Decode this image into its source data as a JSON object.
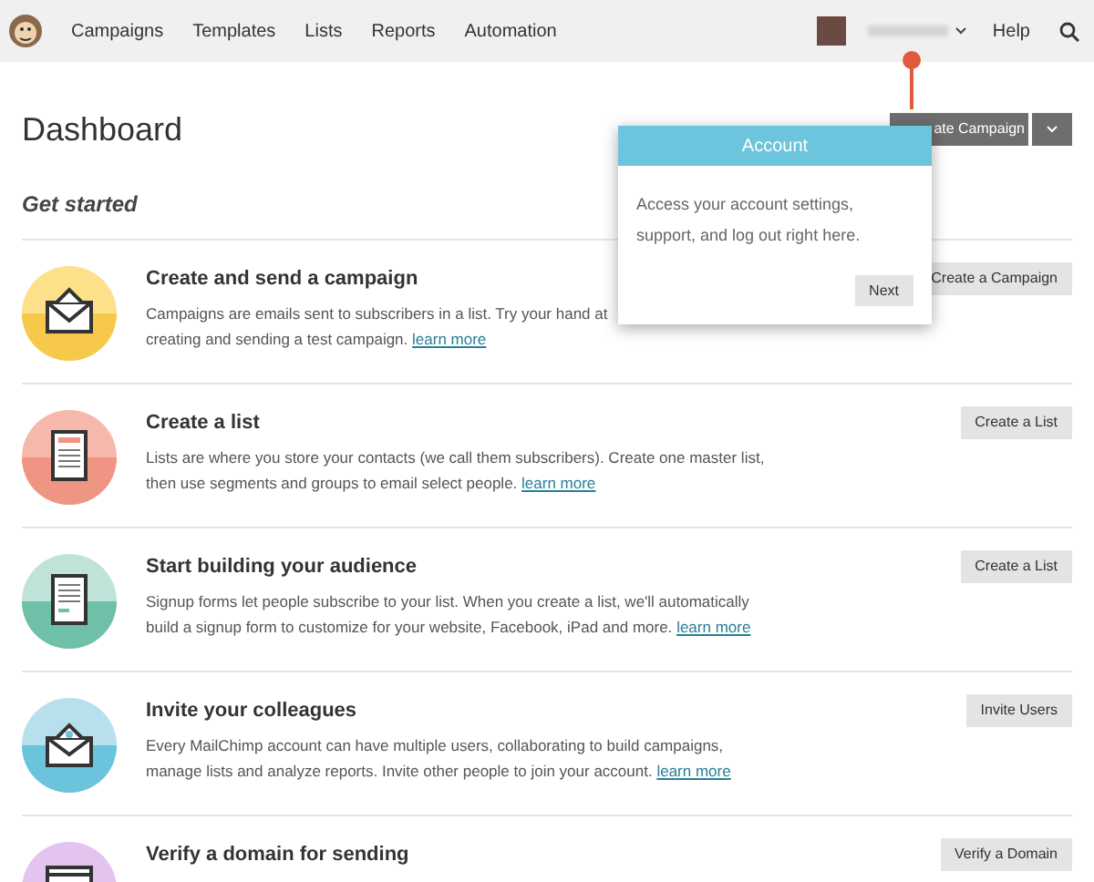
{
  "nav": {
    "items": [
      {
        "label": "Campaigns"
      },
      {
        "label": "Templates"
      },
      {
        "label": "Lists"
      },
      {
        "label": "Reports"
      },
      {
        "label": "Automation"
      }
    ],
    "help": "Help"
  },
  "page_title": "Dashboard",
  "primary_button": "ate Campaign",
  "section_title": "Get started",
  "tasks": [
    {
      "kind": "envelope",
      "title": "Create and send a campaign",
      "lines": [
        "Campaigns are emails sent to subscribers in a list. Try your hand at",
        "creating and sending a test campaign."
      ],
      "link": "learn more",
      "button": "Create a Campaign"
    },
    {
      "kind": "list",
      "title": "Create a list",
      "lines": [
        "Lists are where you store your contacts (we call them subscribers). Create one master list,",
        "then use segments and groups to email select people."
      ],
      "link": "learn more",
      "button": "Create a List"
    },
    {
      "kind": "form",
      "title": "Start building your audience",
      "lines": [
        "Signup forms let people subscribe to your list. When you create a list, we'll automatically",
        "build a signup form to customize for your website, Facebook, iPad and more."
      ],
      "link": "learn more",
      "button": "Create a List"
    },
    {
      "kind": "invite",
      "title": "Invite your colleagues",
      "lines": [
        "Every MailChimp account can have multiple users, collaborating to build campaigns,",
        "manage lists and analyze reports. Invite other people to join your account."
      ],
      "link": "learn more",
      "button": "Invite Users"
    },
    {
      "kind": "domain",
      "title": "Verify a domain for sending",
      "button": "Verify a Domain"
    }
  ],
  "popover": {
    "title": "Account",
    "text": "Access your account settings, support, and log out right here.",
    "button": "Next"
  }
}
